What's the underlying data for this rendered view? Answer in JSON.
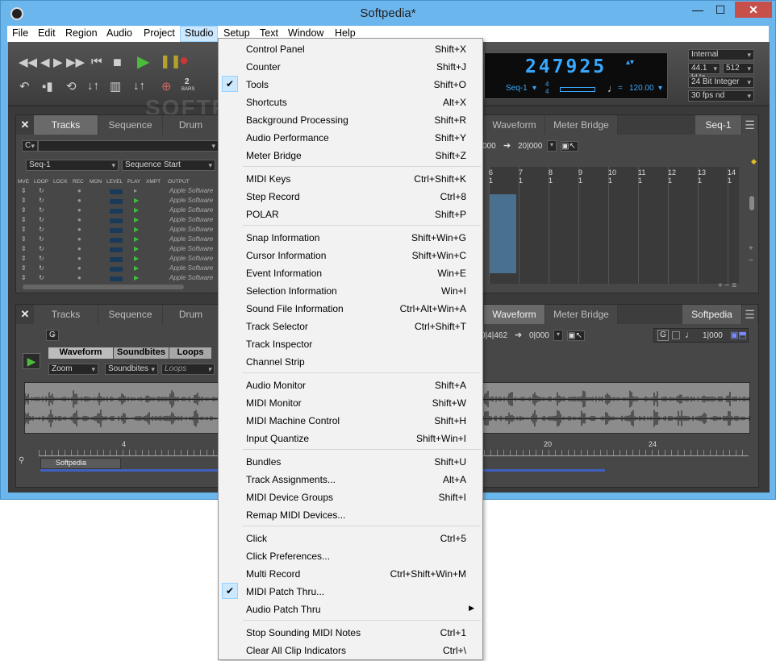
{
  "window": {
    "title": "Softpedia*",
    "min": "—",
    "max": "☐",
    "close": "✕"
  },
  "menubar": [
    "File",
    "Edit",
    "Region",
    "Audio",
    "Project",
    "Studio",
    "Setup",
    "Text",
    "Window",
    "Help"
  ],
  "transport": {
    "counter": "247925",
    "seq": "Seq-1",
    "timesig_top": "4",
    "timesig_bottom": "4",
    "tempo": "120.00",
    "bars_num": "2",
    "bars_label": "BARS",
    "sync": "Internal",
    "sample_rate": "44.1 kHz",
    "buffer": "512",
    "bit_depth": "24 Bit Integer",
    "frame_rate": "30 fps nd",
    "watermark": "SOFTPEDIA"
  },
  "top_panel": {
    "tabs": [
      "Tracks",
      "Sequence",
      "Drum"
    ],
    "right_tabs": [
      "Waveform",
      "Meter Bridge"
    ],
    "seq_label": "Seq-1",
    "c_label": "C",
    "seq_select": "Seq-1",
    "start_select": "Sequence Start",
    "time_a": "000",
    "time_b": "20|000",
    "columns": [
      "MVE",
      "LOOP",
      "LOCK",
      "REC",
      "MON",
      "LEVEL",
      "PLAY",
      "XMPT",
      "OUTPUT"
    ],
    "output": "Apple Software",
    "ruler": [
      "6",
      "7",
      "8",
      "9",
      "10",
      "11",
      "12",
      "13",
      "14"
    ],
    "ruler_sub": "1"
  },
  "bottom_panel": {
    "tabs": [
      "Tracks",
      "Sequence",
      "Drum"
    ],
    "right_tabs": [
      "Waveform",
      "Meter Bridge"
    ],
    "project_label": "Softpedia",
    "c_label": "C",
    "sub_tabs": [
      "Waveform",
      "Soundbites",
      "Loops"
    ],
    "zoom": "Zoom",
    "soundbites": "Soundbites",
    "loops": "Loops",
    "time_a": "0|4|462",
    "time_b": "0|000",
    "g_label": "G",
    "time_c": "1|000",
    "ruler": [
      "4",
      "20",
      "24"
    ],
    "clip": "Softpedia"
  },
  "studio_menu": [
    {
      "label": "Control Panel",
      "shortcut": "Shift+X"
    },
    {
      "label": "Counter",
      "shortcut": "Shift+J"
    },
    {
      "label": "Tools",
      "shortcut": "Shift+O",
      "checked": true
    },
    {
      "label": "Shortcuts",
      "shortcut": "Alt+X"
    },
    {
      "label": "Background Processing",
      "shortcut": "Shift+R"
    },
    {
      "label": "Audio Performance",
      "shortcut": "Shift+Y"
    },
    {
      "label": "Meter Bridge",
      "shortcut": "Shift+Z",
      "sep_after": true
    },
    {
      "label": "MIDI Keys",
      "shortcut": "Ctrl+Shift+K"
    },
    {
      "label": "Step Record",
      "shortcut": "Ctrl+8"
    },
    {
      "label": "POLAR",
      "shortcut": "Shift+P",
      "sep_after": true
    },
    {
      "label": "Snap Information",
      "shortcut": "Shift+Win+G"
    },
    {
      "label": "Cursor Information",
      "shortcut": "Shift+Win+C"
    },
    {
      "label": "Event Information",
      "shortcut": "Win+E"
    },
    {
      "label": "Selection Information",
      "shortcut": "Win+I"
    },
    {
      "label": "Sound File Information",
      "shortcut": "Ctrl+Alt+Win+A"
    },
    {
      "label": "Track Selector",
      "shortcut": "Ctrl+Shift+T"
    },
    {
      "label": "Track Inspector",
      "shortcut": ""
    },
    {
      "label": "Channel Strip",
      "shortcut": "",
      "sep_after": true
    },
    {
      "label": "Audio Monitor",
      "shortcut": "Shift+A"
    },
    {
      "label": "MIDI Monitor",
      "shortcut": "Shift+W"
    },
    {
      "label": "MIDI Machine Control",
      "shortcut": "Shift+H"
    },
    {
      "label": "Input Quantize",
      "shortcut": "Shift+Win+I",
      "sep_after": true
    },
    {
      "label": "Bundles",
      "shortcut": "Shift+U"
    },
    {
      "label": "Track Assignments...",
      "shortcut": "Alt+A"
    },
    {
      "label": "MIDI Device Groups",
      "shortcut": "Shift+I"
    },
    {
      "label": "Remap MIDI Devices...",
      "shortcut": "",
      "sep_after": true
    },
    {
      "label": "Click",
      "shortcut": "Ctrl+5"
    },
    {
      "label": "Click Preferences...",
      "shortcut": ""
    },
    {
      "label": "Multi Record",
      "shortcut": "Ctrl+Shift+Win+M"
    },
    {
      "label": "MIDI Patch Thru...",
      "shortcut": "",
      "checked": true
    },
    {
      "label": "Audio Patch Thru",
      "shortcut": "",
      "submenu": true,
      "sep_after": true
    },
    {
      "label": "Stop Sounding MIDI Notes",
      "shortcut": "Ctrl+1"
    },
    {
      "label": "Clear All Clip Indicators",
      "shortcut": "Ctrl+\\"
    }
  ]
}
